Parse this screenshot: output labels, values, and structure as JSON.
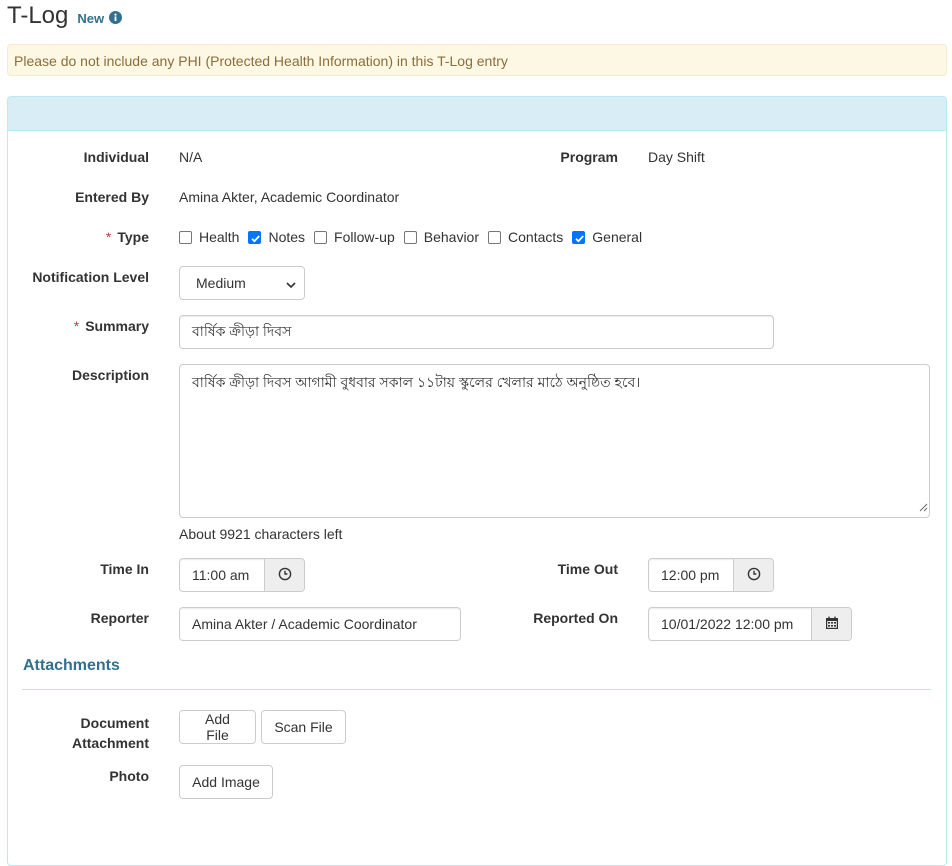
{
  "header": {
    "title": "T-Log",
    "status": "New"
  },
  "alert": {
    "text": "Please do not include any PHI (Protected Health Information) in this T-Log entry"
  },
  "form": {
    "individual": {
      "label": "Individual",
      "value": "N/A"
    },
    "program": {
      "label": "Program",
      "value": "Day Shift"
    },
    "entered_by": {
      "label": "Entered By",
      "value": "Amina Akter, Academic Coordinator"
    },
    "type": {
      "label": "Type",
      "required_mark": "*",
      "options": [
        {
          "label": "Health",
          "checked": false
        },
        {
          "label": "Notes",
          "checked": true
        },
        {
          "label": "Follow-up",
          "checked": false
        },
        {
          "label": "Behavior",
          "checked": false
        },
        {
          "label": "Contacts",
          "checked": false
        },
        {
          "label": "General",
          "checked": true
        }
      ]
    },
    "notification_level": {
      "label": "Notification Level",
      "value": "Medium"
    },
    "summary": {
      "label": "Summary",
      "required_mark": "*",
      "value": "বার্ষিক ক্রীড়া দিবস"
    },
    "description": {
      "label": "Description",
      "value": "বার্ষিক ক্রীড়া দিবস আগামী বুধবার সকাল ১১টায় স্কুলের খেলার মাঠে অনুষ্ঠিত হবে।",
      "chars_left": "About 9921 characters left"
    },
    "time_in": {
      "label": "Time In",
      "value": "11:00 am"
    },
    "time_out": {
      "label": "Time Out",
      "value": "12:00 pm"
    },
    "reporter": {
      "label": "Reporter",
      "value": "Amina Akter / Academic Coordinator"
    },
    "reported_on": {
      "label": "Reported On",
      "value": "10/01/2022 12:00 pm"
    }
  },
  "attachments": {
    "title": "Attachments",
    "document_label_line1": "Document",
    "document_label_line2": "Attachment",
    "add_file": "Add File",
    "scan_file": "Scan File",
    "photo_label": "Photo",
    "add_image": "Add Image"
  },
  "colors": {
    "accent": "#31708f",
    "alert_bg": "#fcf8e3",
    "panel_heading": "#d9edf7",
    "checkbox_checked": "#0075ff",
    "required": "#a94442"
  }
}
